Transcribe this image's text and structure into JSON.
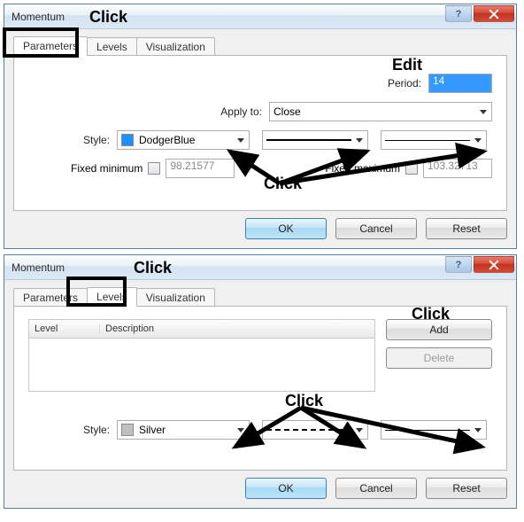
{
  "dialog1": {
    "title": "Momentum",
    "tabs": {
      "parameters": "Parameters",
      "levels": "Levels",
      "visualization": "Visualization"
    },
    "period_label": "Period:",
    "period_value": "14",
    "apply_label": "Apply to:",
    "apply_value": "Close",
    "style_label": "Style:",
    "style_color_name": "DodgerBlue",
    "style_color_hex": "#1E90FF",
    "fixed_min_label": "Fixed minimum",
    "fixed_min_value": "98.21577",
    "fixed_max_label": "Fixed maximum",
    "fixed_max_value": "103.32713",
    "ok": "OK",
    "cancel": "Cancel",
    "reset": "Reset",
    "anno_click_tab": "Click",
    "anno_edit": "Edit",
    "anno_click_combos": "Click"
  },
  "dialog2": {
    "title": "Momentum",
    "tabs": {
      "parameters": "Parameters",
      "levels": "Levels",
      "visualization": "Visualization"
    },
    "col_level": "Level",
    "col_desc": "Description",
    "add": "Add",
    "delete": "Delete",
    "style_label": "Style:",
    "style_color_name": "Silver",
    "style_color_hex": "#C0C0C0",
    "ok": "OK",
    "cancel": "Cancel",
    "reset": "Reset",
    "anno_click_tab": "Click",
    "anno_click_add": "Click",
    "anno_click_combos": "Click"
  }
}
